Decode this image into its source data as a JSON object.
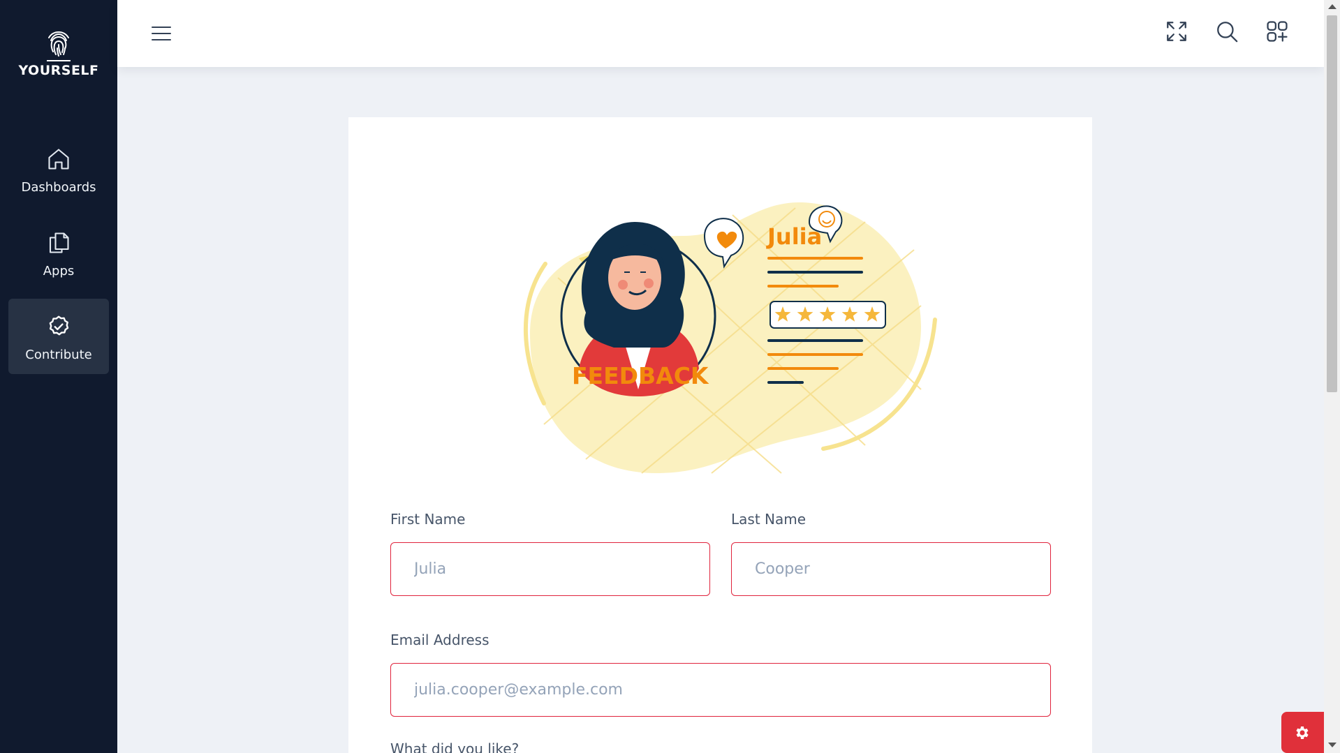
{
  "brand": {
    "name": "YOURSELF",
    "logo_icon": "fingerprint-icon"
  },
  "sidebar": {
    "items": [
      {
        "label": "Dashboards",
        "icon": "home-icon",
        "active": false
      },
      {
        "label": "Apps",
        "icon": "copy-icon",
        "active": false
      },
      {
        "label": "Contribute",
        "icon": "check-circle-icon",
        "active": true
      }
    ]
  },
  "header": {
    "menu_icon": "hamburger-menu-icon",
    "actions": [
      "fullscreen-icon",
      "search-icon",
      "apps-add-icon"
    ]
  },
  "illustration": {
    "title_text": "FEEDBACK",
    "name_text": "Julia",
    "stars": 5
  },
  "form": {
    "first_name": {
      "label": "First Name",
      "value": "",
      "placeholder": "Julia"
    },
    "last_name": {
      "label": "Last Name",
      "value": "",
      "placeholder": "Cooper"
    },
    "email": {
      "label": "Email Address",
      "value": "",
      "placeholder": "julia.cooper@example.com"
    },
    "liked": {
      "label": "What did you like?"
    }
  },
  "colors": {
    "sidebar_bg": "#101a2e",
    "sidebar_active": "#273244",
    "page_bg": "#eef1f6",
    "input_border": "#e0233c",
    "accent_orange": "#f28a0c",
    "illustration_yellow": "#fbf1c0",
    "fab_red": "#e0303a"
  },
  "settings_fab_icon": "gear-icon"
}
